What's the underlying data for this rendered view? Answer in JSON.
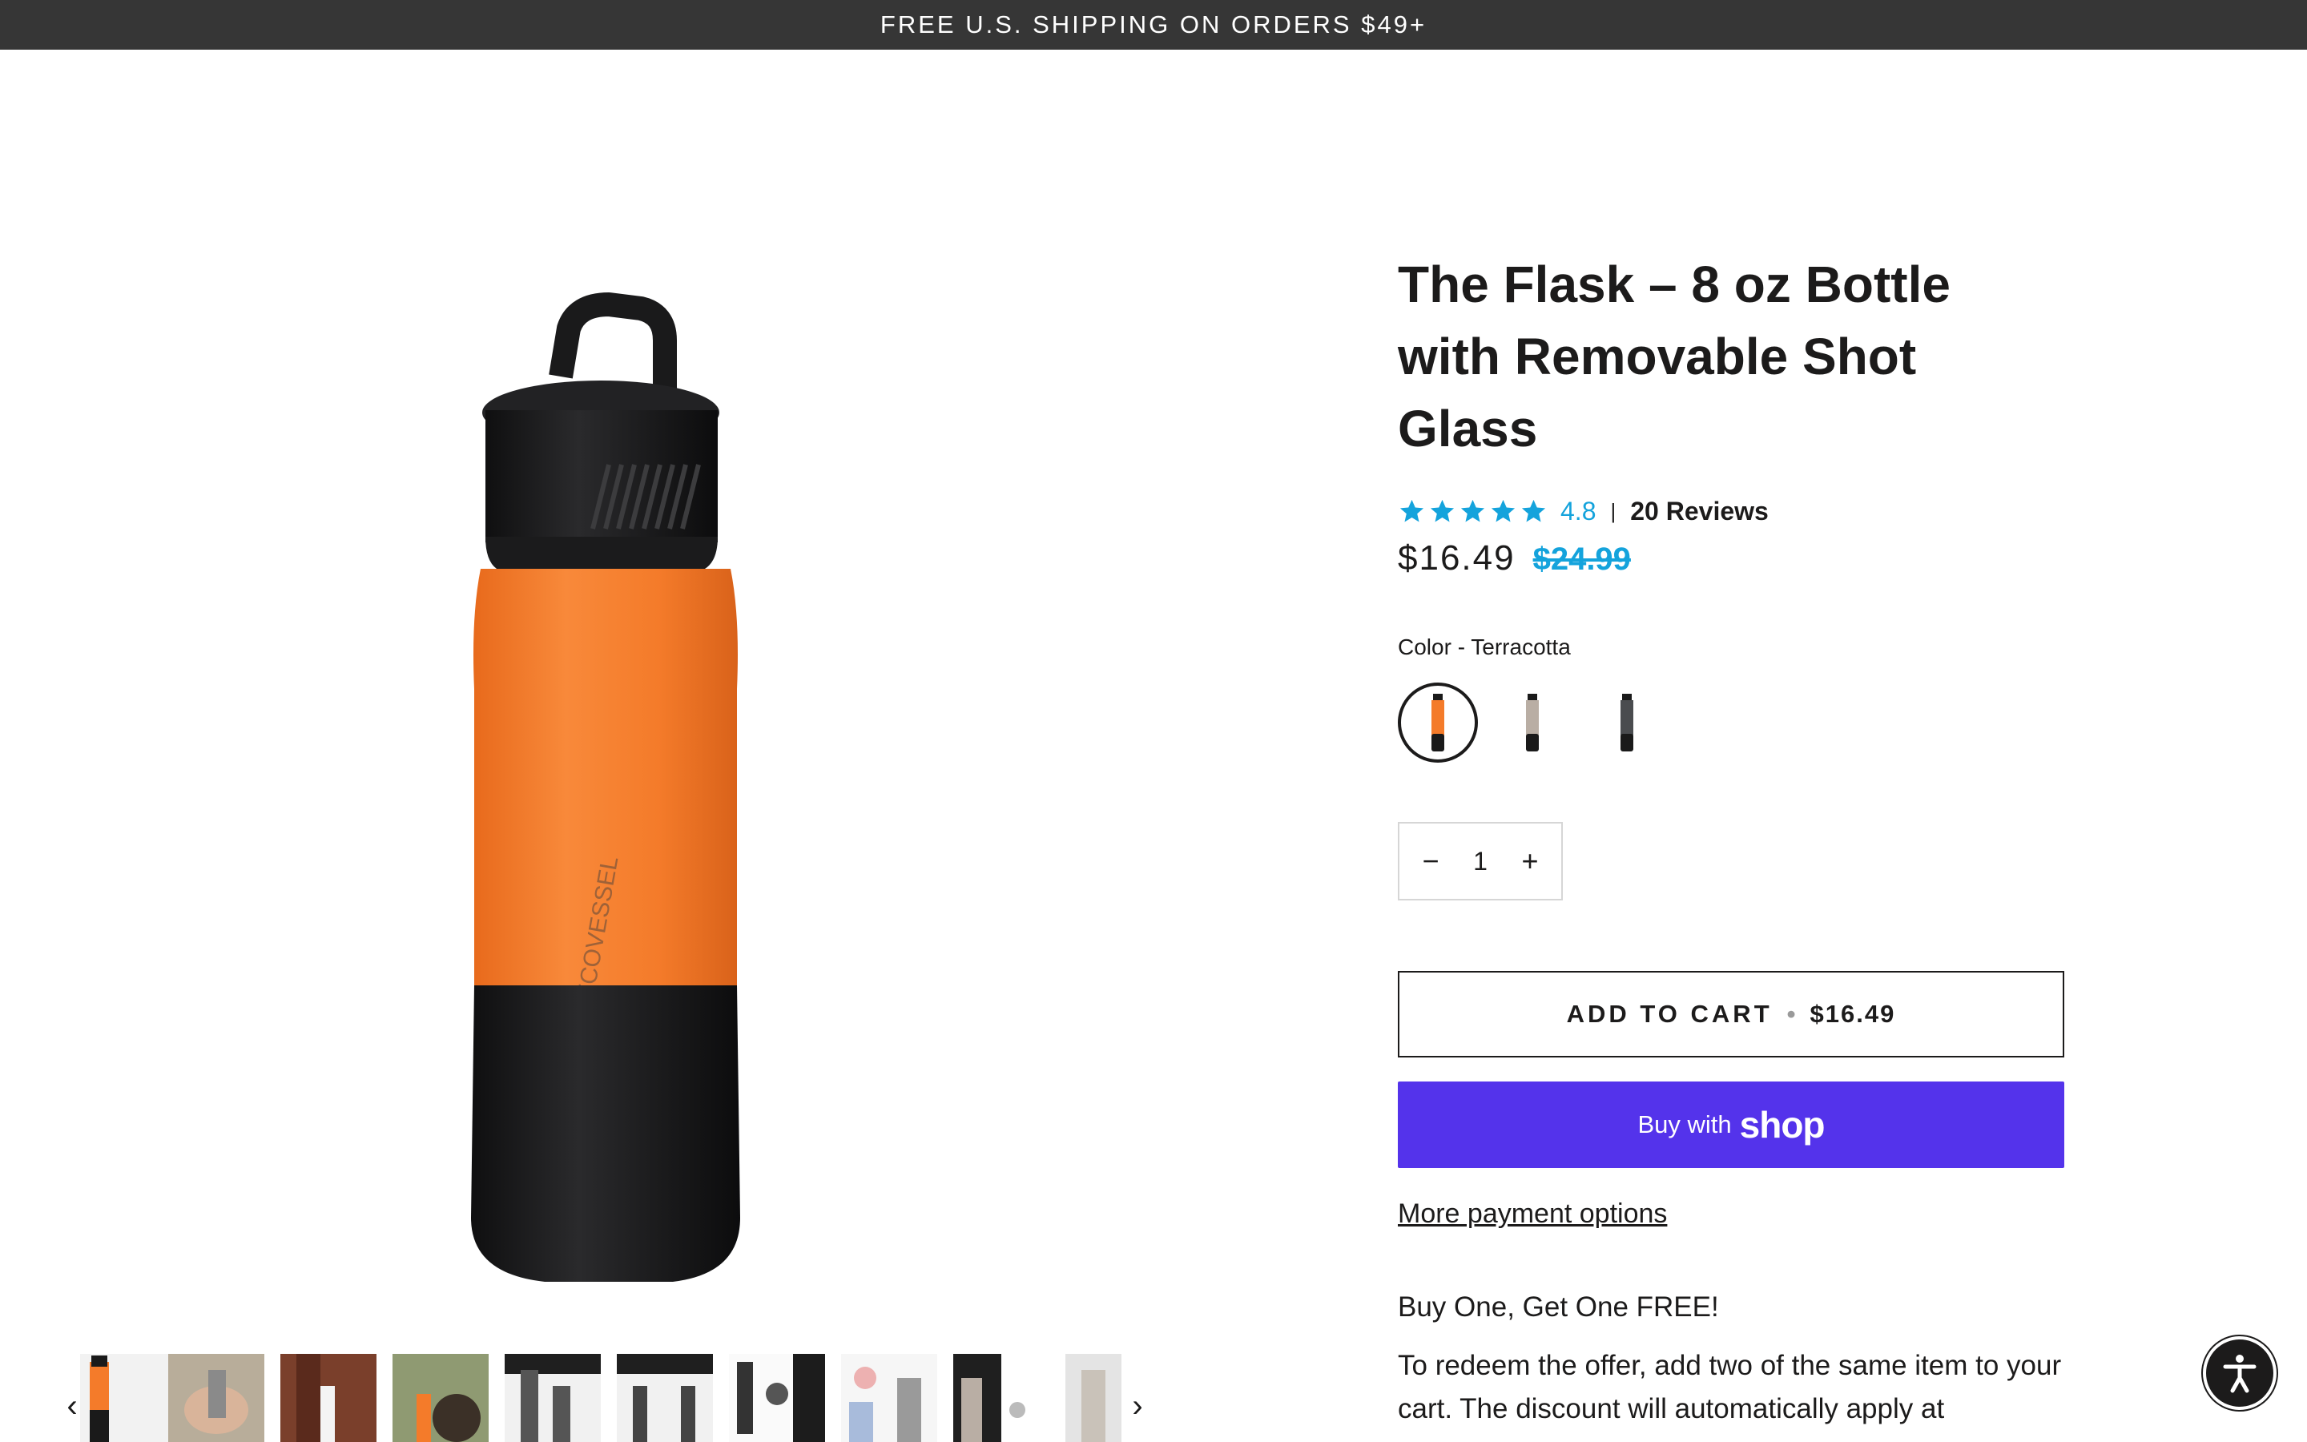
{
  "announcement": {
    "text": "FREE U.S. SHIPPING ON ORDERS $49+"
  },
  "product": {
    "title": "The Flask – 8 oz Bottle with Removable Shot Glass",
    "rating": {
      "value": "4.8",
      "separator": "|",
      "reviews_label": "20 Reviews",
      "stars": 5,
      "star_color": "#14a3dc"
    },
    "price": "$16.49",
    "compare_price": "$24.99",
    "color_label": "Color - Terracotta",
    "swatches": [
      {
        "name": "Terracotta",
        "color": "#f47b2a",
        "selected": true
      },
      {
        "name": "Stone",
        "color": "#b9aea4",
        "selected": false
      },
      {
        "name": "Charcoal",
        "color": "#4a4c4f",
        "selected": false
      }
    ],
    "quantity": {
      "minus": "−",
      "value": "1",
      "plus": "+"
    },
    "add_to_cart": {
      "label": "ADD TO CART",
      "dot": "•",
      "price": "$16.49"
    },
    "shop_pay": {
      "buy_with": "Buy with",
      "shop": "shop",
      "color": "#5433eb"
    },
    "more_payment": "More payment options",
    "promo": {
      "heading": "Buy One, Get One FREE!",
      "body": "To redeem the offer, add two of the same item to your cart. The discount will automatically apply at"
    }
  },
  "gallery": {
    "prev_icon": "‹",
    "next_icon": "›",
    "thumbnails": 10
  }
}
